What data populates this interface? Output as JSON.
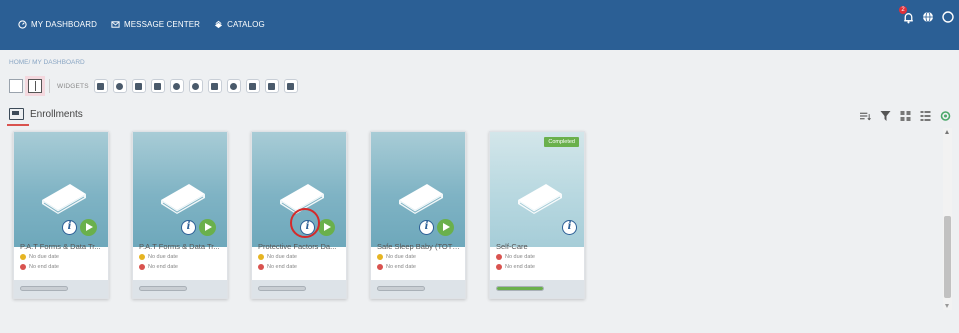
{
  "header": {
    "nav": [
      {
        "label": "MY DASHBOARD",
        "icon": "dashboard-icon"
      },
      {
        "label": "MESSAGE CENTER",
        "icon": "message-icon"
      },
      {
        "label": "CATALOG",
        "icon": "catalog-icon"
      }
    ],
    "notification_count": "2",
    "icons": [
      "bell-icon",
      "globe-icon",
      "help-icon"
    ]
  },
  "breadcrumb": {
    "home": "HOME",
    "current": "/ MY DASHBOARD"
  },
  "widgets": {
    "label": "WIDGETS",
    "count": 11
  },
  "section": {
    "title": "Enrollments"
  },
  "cards": [
    {
      "title": "P.A.T Forms & Data Tr...",
      "due": "No due date",
      "end": "No end date",
      "progress": 0,
      "has_play": true,
      "completed_badge": ""
    },
    {
      "title": "P.A.T Forms & Data Tr...",
      "due": "No due date",
      "end": "No end date",
      "progress": 0,
      "has_play": true,
      "completed_badge": ""
    },
    {
      "title": "Protective Factors Da...",
      "due": "No due date",
      "end": "No end date",
      "progress": 0,
      "has_play": true,
      "completed_badge": "",
      "highlighted": true
    },
    {
      "title": "Safe Sleep Baby (TOT)...",
      "due": "No due date",
      "end": "No end date",
      "progress": 0,
      "has_play": true,
      "completed_badge": ""
    },
    {
      "title": "Self-Care",
      "due": "No due date",
      "end": "No end date",
      "progress": 100,
      "has_play": false,
      "completed_badge": "Completed"
    }
  ],
  "colors": {
    "header": "#2b5f95",
    "accent_green": "#6ab04c",
    "alert_red": "#d9534f"
  }
}
